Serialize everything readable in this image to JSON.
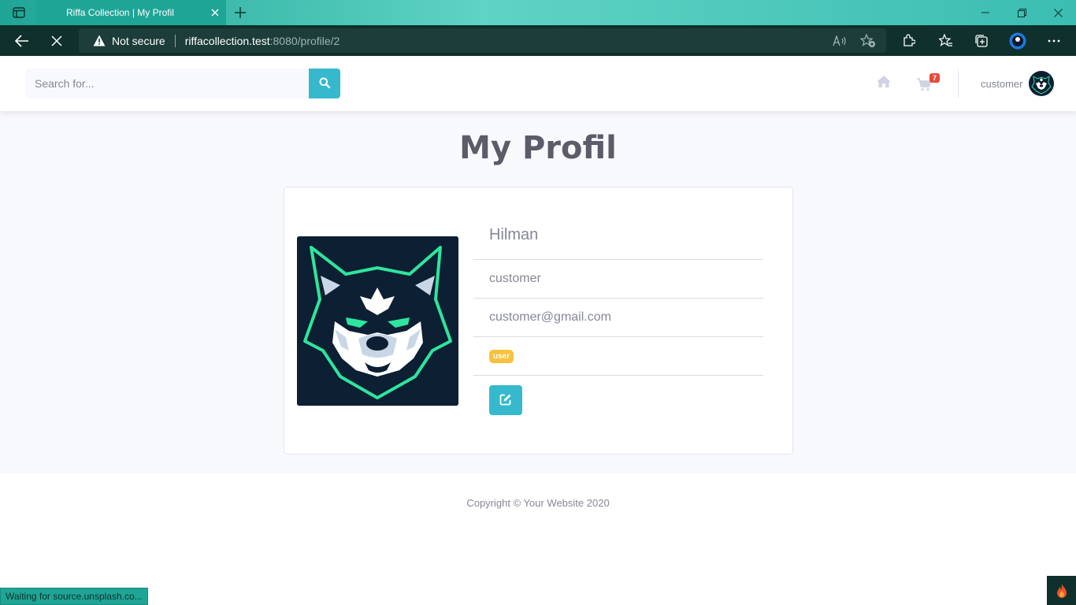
{
  "browser": {
    "tab_title": "Riffa Collection | My Profil",
    "not_secure_label": "Not secure",
    "url_host": "riffacollection.test",
    "url_rest": ":8080/profile/2",
    "status_text": "Waiting for source.unsplash.co..."
  },
  "topbar": {
    "search_placeholder": "Search for...",
    "cart_count": "7",
    "username": "customer"
  },
  "page": {
    "title": "My Profil"
  },
  "profile": {
    "name": "Hilman",
    "username": "customer",
    "email": "customer@gmail.com",
    "role": "user"
  },
  "footer": {
    "copyright": "Copyright © Your Website 2020"
  },
  "colors": {
    "accent": "#36b9cc",
    "badge_warning": "#f6c23e",
    "cart_badge": "#e74a3b",
    "tabbar": "#1fa596",
    "wolf_outline": "#2ee59d"
  }
}
